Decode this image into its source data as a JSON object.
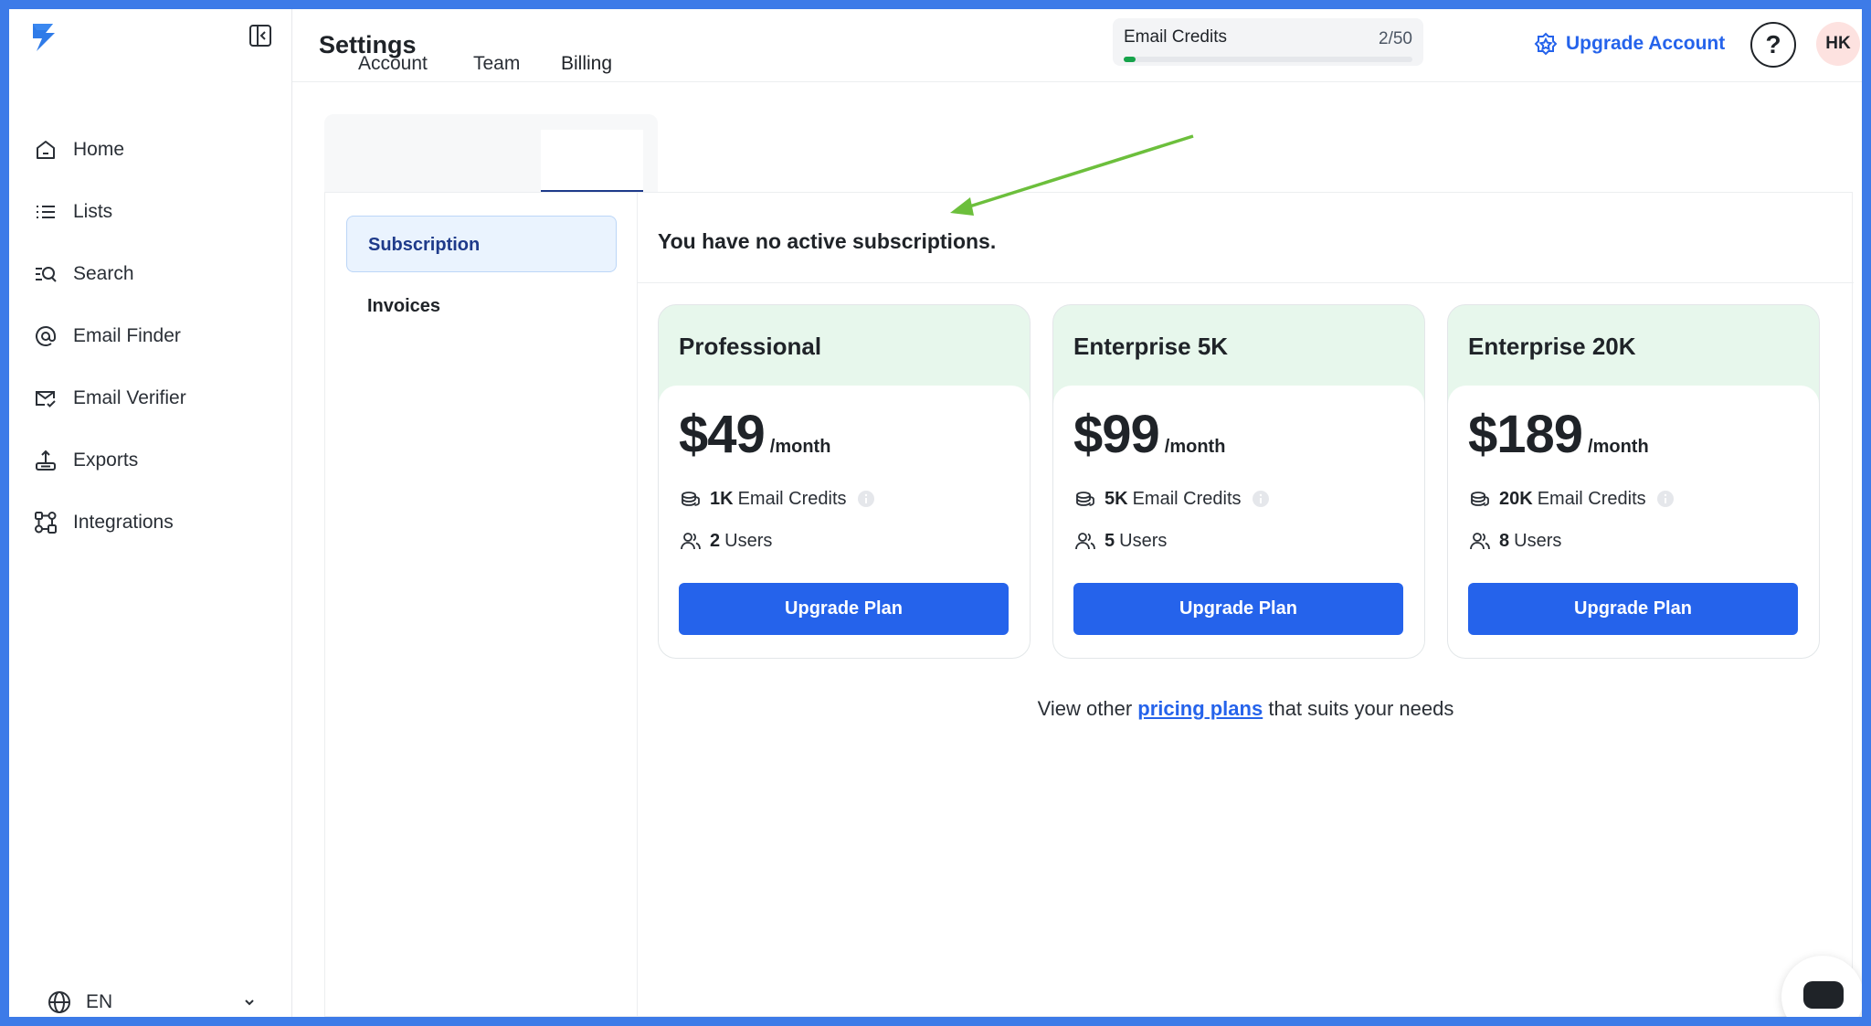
{
  "header": {
    "title": "Settings",
    "credits_label": "Email Credits",
    "credits_value": "2/50",
    "credits_fraction": 0.04,
    "upgrade_label": "Upgrade Account",
    "help_label": "?",
    "avatar_initials": "HK"
  },
  "sidebar": {
    "items": [
      {
        "label": "Home",
        "icon": "home-icon"
      },
      {
        "label": "Lists",
        "icon": "list-icon"
      },
      {
        "label": "Search",
        "icon": "search-icon"
      },
      {
        "label": "Email Finder",
        "icon": "at-icon"
      },
      {
        "label": "Email Verifier",
        "icon": "mail-check-icon"
      },
      {
        "label": "Exports",
        "icon": "export-icon"
      },
      {
        "label": "Integrations",
        "icon": "integrations-icon"
      }
    ],
    "language": "EN"
  },
  "tabs": [
    {
      "label": "Account"
    },
    {
      "label": "Team"
    },
    {
      "label": "Billing"
    }
  ],
  "subnav": [
    {
      "label": "Subscription"
    },
    {
      "label": "Invoices"
    }
  ],
  "content": {
    "status": "You have no active subscriptions.",
    "plans": [
      {
        "name": "Professional",
        "price": "$49",
        "per": "/month",
        "credits_amount": "1K",
        "credits_label": "Email Credits",
        "users_amount": "2",
        "users_label": "Users",
        "button": "Upgrade Plan"
      },
      {
        "name": "Enterprise 5K",
        "price": "$99",
        "per": "/month",
        "credits_amount": "5K",
        "credits_label": "Email Credits",
        "users_amount": "5",
        "users_label": "Users",
        "button": "Upgrade Plan"
      },
      {
        "name": "Enterprise 20K",
        "price": "$189",
        "per": "/month",
        "credits_amount": "20K",
        "credits_label": "Email Credits",
        "users_amount": "8",
        "users_label": "Users",
        "button": "Upgrade Plan"
      }
    ],
    "pricing_prefix": "View other",
    "pricing_link": "pricing plans",
    "pricing_suffix": "that suits your needs"
  },
  "colors": {
    "accent": "#2563eb",
    "plan_header_bg": "#e7f7ec",
    "progress": "#16a34a",
    "annotation_arrow": "#6cbf3c"
  }
}
